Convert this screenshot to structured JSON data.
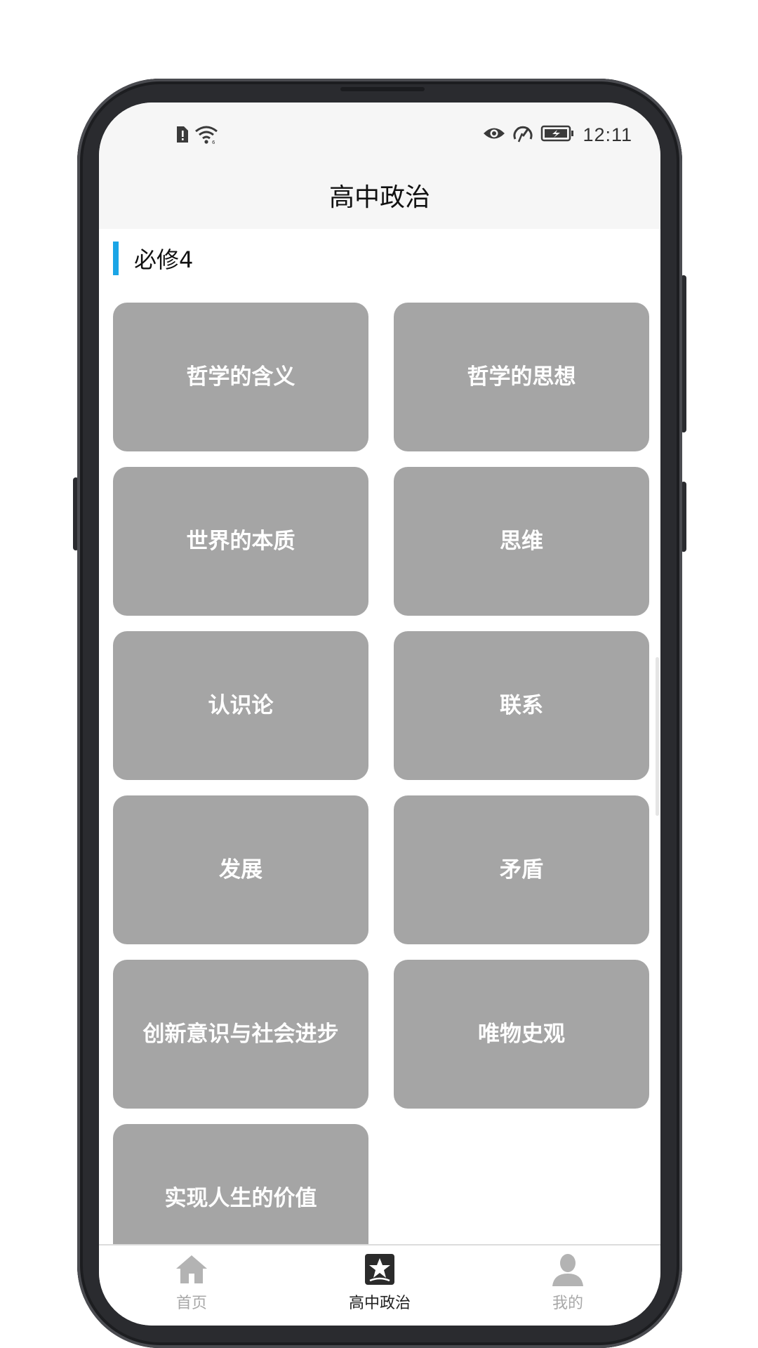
{
  "status_bar": {
    "time": "12:11",
    "left_icons": [
      "sim-alert-icon",
      "wifi-icon"
    ],
    "right_icons": [
      "eye-icon",
      "speed-icon",
      "battery-icon"
    ]
  },
  "header": {
    "title": "高中政治"
  },
  "section": {
    "label": "必修4",
    "accent_color": "#1aa5e6"
  },
  "cards": [
    {
      "label": "哲学的含义"
    },
    {
      "label": "哲学的思想"
    },
    {
      "label": "世界的本质"
    },
    {
      "label": "思维"
    },
    {
      "label": "认识论"
    },
    {
      "label": "联系"
    },
    {
      "label": "发展"
    },
    {
      "label": "矛盾"
    },
    {
      "label": "创新意识与社会进步"
    },
    {
      "label": "唯物史观"
    },
    {
      "label": "实现人生的价值"
    }
  ],
  "card_color": "#a5a5a5",
  "bottom_nav": {
    "items": [
      {
        "label": "首页",
        "icon": "home-icon",
        "active": false
      },
      {
        "label": "高中政治",
        "icon": "star-book-icon",
        "active": true
      },
      {
        "label": "我的",
        "icon": "person-icon",
        "active": false
      }
    ]
  }
}
